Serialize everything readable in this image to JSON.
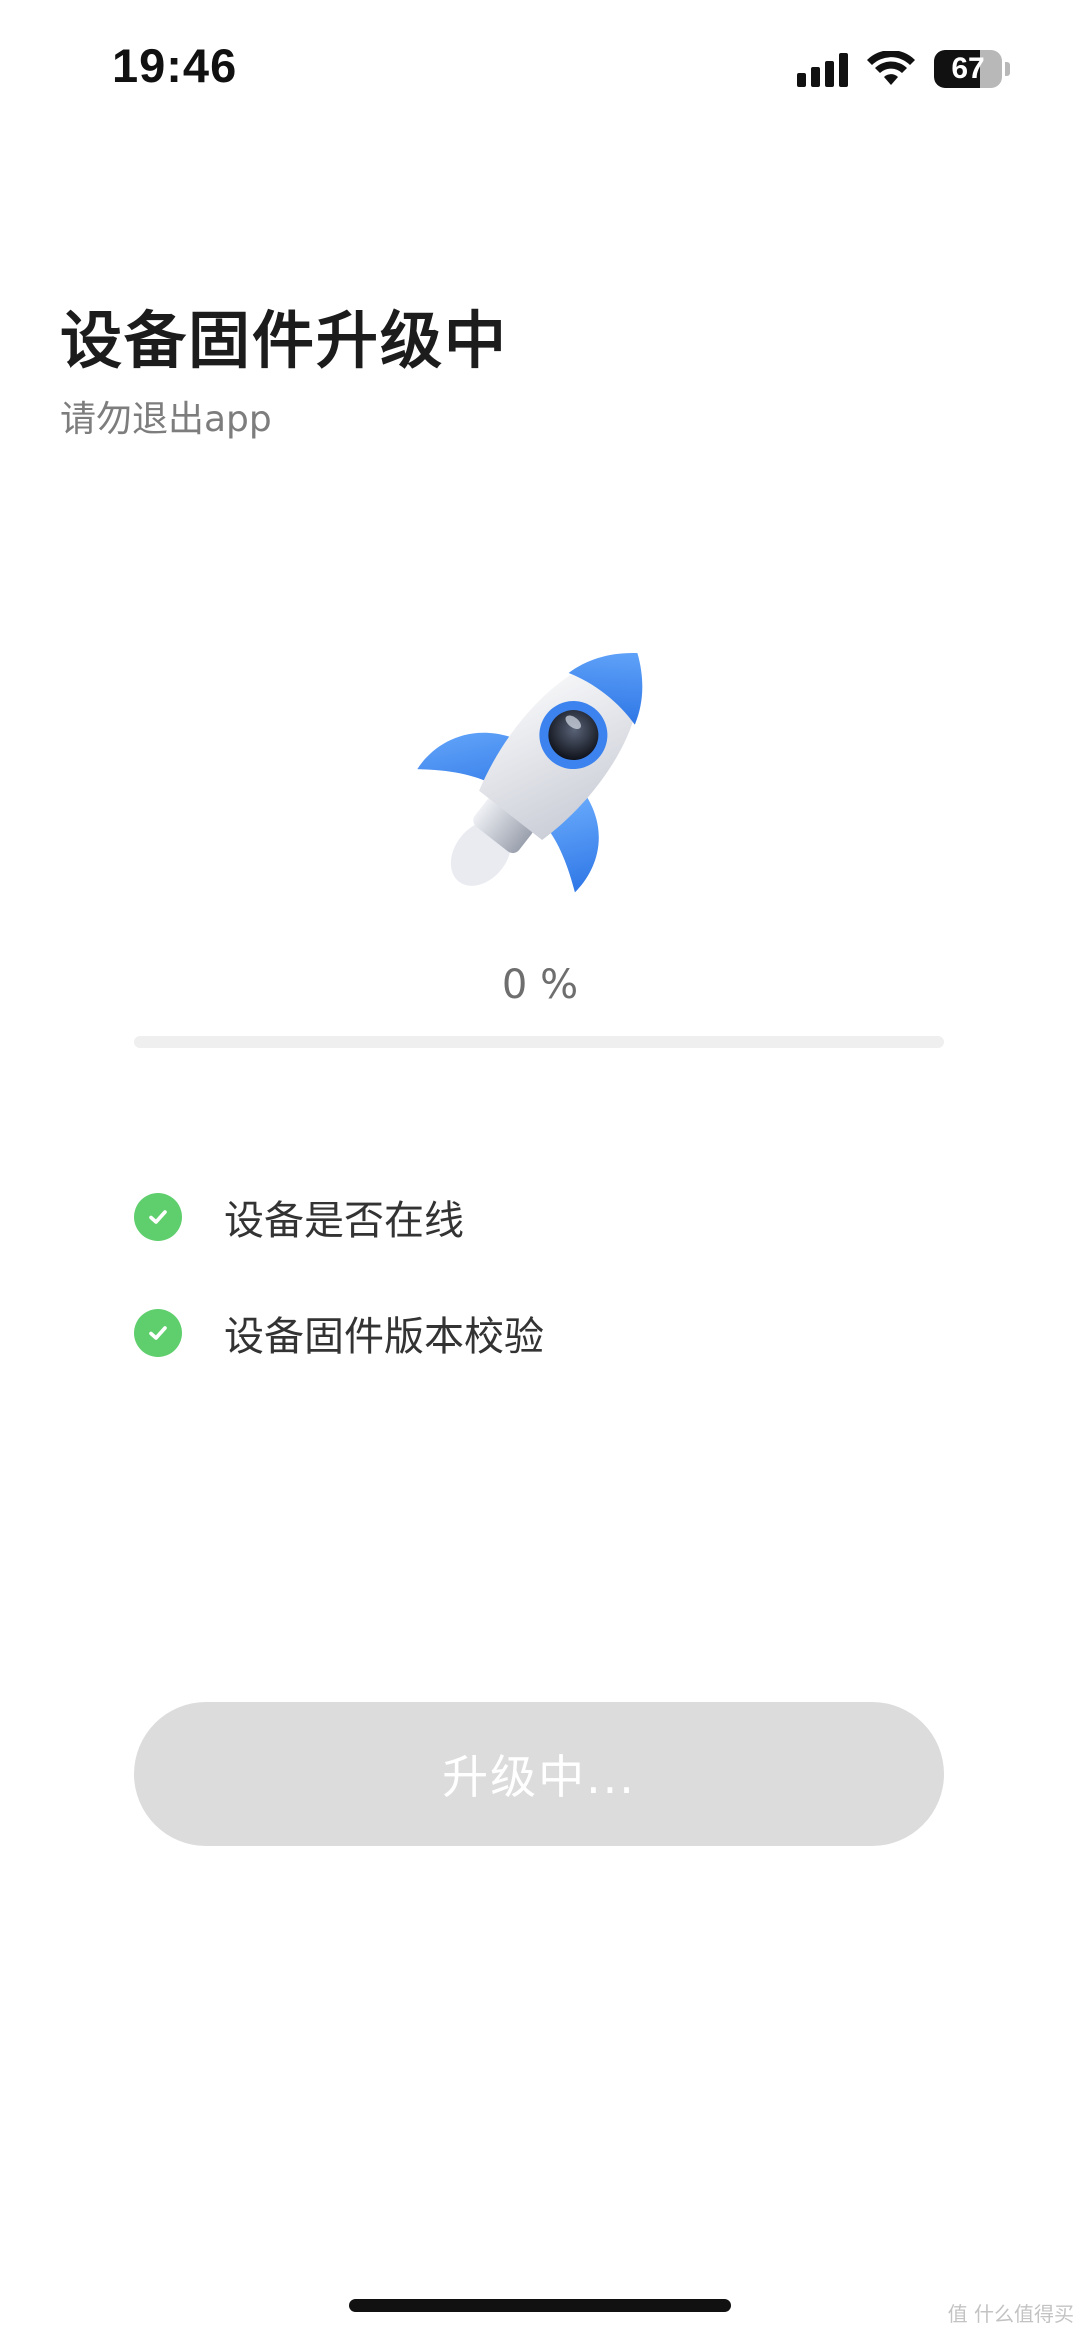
{
  "status_bar": {
    "time": "19:46",
    "battery_level": "67",
    "battery_fraction": 0.67,
    "icons": [
      "signal-icon",
      "wifi-icon",
      "battery-icon"
    ]
  },
  "header": {
    "title": "设备固件升级中",
    "subtitle": "请勿退出app"
  },
  "progress": {
    "label": "0 %",
    "value": 0
  },
  "checklist": [
    {
      "label": "设备是否在线",
      "status": "done",
      "icon": "check-circle-icon"
    },
    {
      "label": "设备固件版本校验",
      "status": "done",
      "icon": "check-circle-icon"
    }
  ],
  "button": {
    "label": "升级中..."
  },
  "watermark": "值 什么值得买",
  "colors": {
    "check_green": "#5fcf6d",
    "button_bg": "#dcdcdc",
    "track": "#efefef",
    "rocket_blue": "#3d8bf2"
  }
}
